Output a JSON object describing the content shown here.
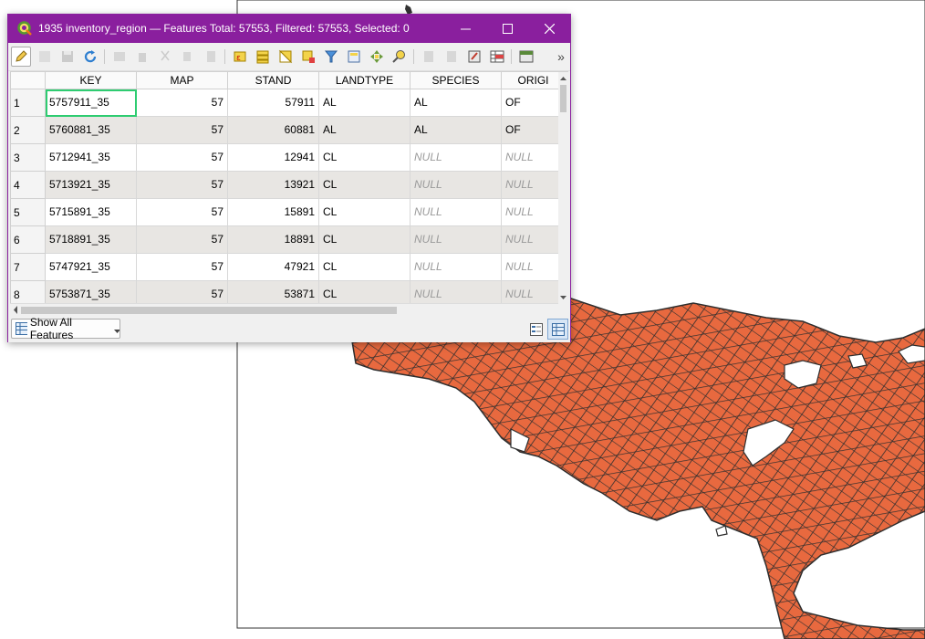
{
  "window": {
    "title": "1935 inventory_region — Features Total: 57553, Filtered: 57553, Selected: 0",
    "accent_color": "#8a1f9e"
  },
  "toolbar": {
    "icons": [
      "pencil-icon",
      "multi-edit-icon",
      "save-edits-icon",
      "reload-icon",
      "add-feature-icon",
      "delete-feature-icon",
      "cut-icon",
      "copy-icon",
      "paste-icon",
      "select-by-expression-icon",
      "select-all-icon",
      "invert-selection-icon",
      "deselect-all-icon",
      "filter-icon",
      "move-selection-top-icon",
      "pan-to-selection-icon",
      "zoom-to-selection-icon",
      "new-field-icon",
      "delete-field-icon",
      "field-calculator-icon",
      "conditional-formatting-icon",
      "dock-attribute-table-icon",
      "more-chevron-icon"
    ]
  },
  "table": {
    "columns": [
      "KEY",
      "MAP",
      "STAND",
      "LANDTYPE",
      "SPECIES",
      "ORIGI"
    ],
    "rows": [
      {
        "n": "1",
        "key": "5757911_35",
        "map": "57",
        "stand": "57911",
        "landtype": "AL",
        "species": "AL",
        "origin": "OF"
      },
      {
        "n": "2",
        "key": "5760881_35",
        "map": "57",
        "stand": "60881",
        "landtype": "AL",
        "species": "AL",
        "origin": "OF"
      },
      {
        "n": "3",
        "key": "5712941_35",
        "map": "57",
        "stand": "12941",
        "landtype": "CL",
        "species": "NULL",
        "origin": "NULL"
      },
      {
        "n": "4",
        "key": "5713921_35",
        "map": "57",
        "stand": "13921",
        "landtype": "CL",
        "species": "NULL",
        "origin": "NULL"
      },
      {
        "n": "5",
        "key": "5715891_35",
        "map": "57",
        "stand": "15891",
        "landtype": "CL",
        "species": "NULL",
        "origin": "NULL"
      },
      {
        "n": "6",
        "key": "5718891_35",
        "map": "57",
        "stand": "18891",
        "landtype": "CL",
        "species": "NULL",
        "origin": "NULL"
      },
      {
        "n": "7",
        "key": "5747921_35",
        "map": "57",
        "stand": "47921",
        "landtype": "CL",
        "species": "NULL",
        "origin": "NULL"
      },
      {
        "n": "8",
        "key": "5753871_35",
        "map": "57",
        "stand": "53871",
        "landtype": "CL",
        "species": "NULL",
        "origin": "NULL"
      }
    ]
  },
  "bottom": {
    "show_all_label": "Show All Features"
  },
  "map": {
    "fill_color": "#e8693f",
    "outline_color": "#2e2e2e"
  }
}
